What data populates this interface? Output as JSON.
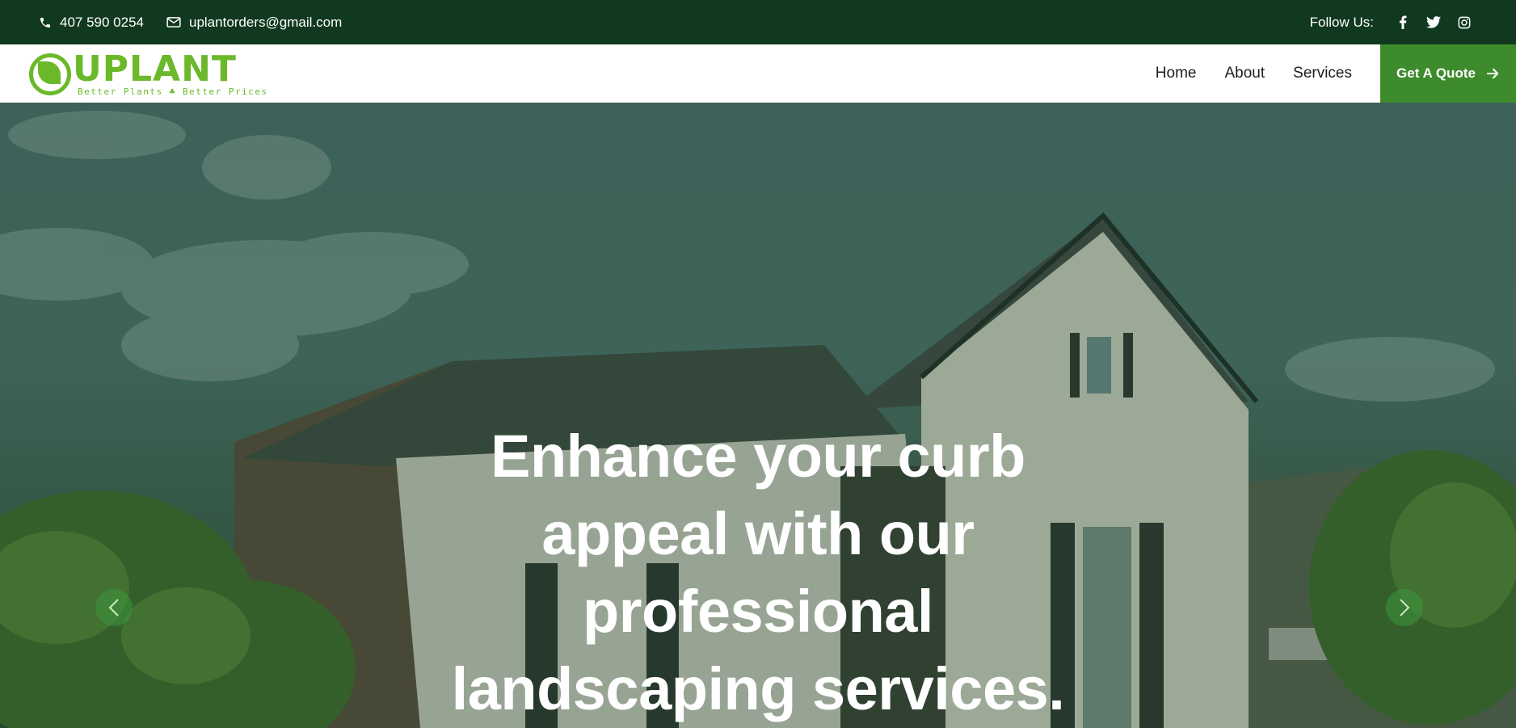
{
  "topbar": {
    "phone": "407 590 0254",
    "email": "uplantorders@gmail.com",
    "follow_label": "Follow Us:",
    "social_icons": [
      "facebook-icon",
      "twitter-icon",
      "instagram-icon"
    ]
  },
  "logo": {
    "name": "UPLANT",
    "tagline": "Better Plants ♣ Better Prices"
  },
  "nav": {
    "items": [
      "Home",
      "About",
      "Services"
    ],
    "cta_label": "Get A Quote"
  },
  "hero": {
    "title_lines": [
      "Enhance your curb",
      "appeal with our",
      "professional",
      "landscaping services."
    ]
  },
  "colors": {
    "topbar_bg": "#11391f",
    "brand_green": "#6bb92a",
    "cta_green": "#3e8b2d"
  }
}
